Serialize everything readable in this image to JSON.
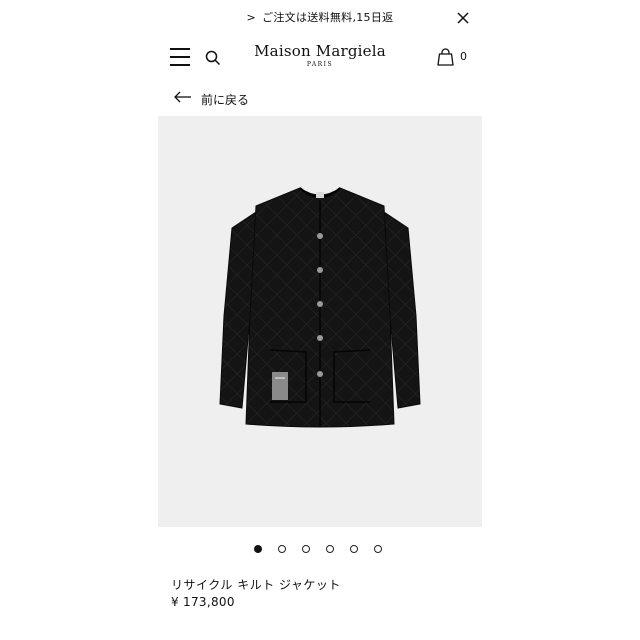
{
  "announcement": {
    "arrow": ">",
    "text": "ご注文は送料無料,15日返"
  },
  "header": {
    "logo_main": "Maison Margiela",
    "logo_sub": "PARIS",
    "cart_count": "0",
    "icons": [
      "menu-icon",
      "search-icon",
      "shopping-bag-icon",
      "close-icon"
    ]
  },
  "back_link": {
    "label": "前に戻る"
  },
  "gallery": {
    "image_count": 6,
    "active_index": 0
  },
  "product": {
    "name": "リサイクル キルト ジャケット",
    "price": "¥ 173,800"
  },
  "colors": {
    "text": "#111111",
    "image_background": "#efefef",
    "garment": "#141414"
  }
}
